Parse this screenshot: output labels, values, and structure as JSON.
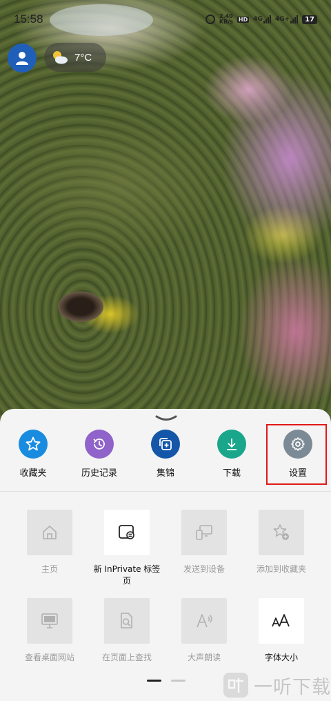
{
  "status_bar": {
    "time": "15:58",
    "net_speed_value": "2.40",
    "net_speed_unit": "KB/s",
    "hd_label": "HD",
    "signal1_label": "4G",
    "signal2_label": "4G+",
    "battery": "17"
  },
  "top_overlay": {
    "weather_temp": "7°C"
  },
  "sheet": {
    "quick_actions": [
      {
        "label": "收藏夹",
        "icon": "star-icon",
        "color": "#1a8ce0"
      },
      {
        "label": "历史记录",
        "icon": "history-icon",
        "color": "#8f63c9"
      },
      {
        "label": "集锦",
        "icon": "collections-icon",
        "color": "#1456a8"
      },
      {
        "label": "下载",
        "icon": "download-icon",
        "color": "#1aa68a"
      },
      {
        "label": "设置",
        "icon": "gear-icon",
        "color": "#7b8a94"
      }
    ],
    "grid_items": [
      {
        "label": "主页",
        "icon": "home-icon",
        "enabled": false
      },
      {
        "label": "新 InPrivate 标签页",
        "icon": "inprivate-tab-icon",
        "enabled": true
      },
      {
        "label": "发送到设备",
        "icon": "send-to-device-icon",
        "enabled": false
      },
      {
        "label": "添加到收藏夹",
        "icon": "add-favorite-icon",
        "enabled": false
      },
      {
        "label": "查看桌面网站",
        "icon": "desktop-site-icon",
        "enabled": false
      },
      {
        "label": "在页面上查找",
        "icon": "find-in-page-icon",
        "enabled": false
      },
      {
        "label": "大声朗读",
        "icon": "read-aloud-icon",
        "enabled": false
      },
      {
        "label": "字体大小",
        "icon": "font-size-icon",
        "enabled": true
      }
    ],
    "page_indicator": {
      "current": 1,
      "total": 2
    }
  },
  "watermark": {
    "text": "一听下载"
  },
  "colors": {
    "highlight": "#e01818",
    "sheet_bg": "#f4f4f4",
    "tile_disabled_bg": "#e3e3e3"
  }
}
